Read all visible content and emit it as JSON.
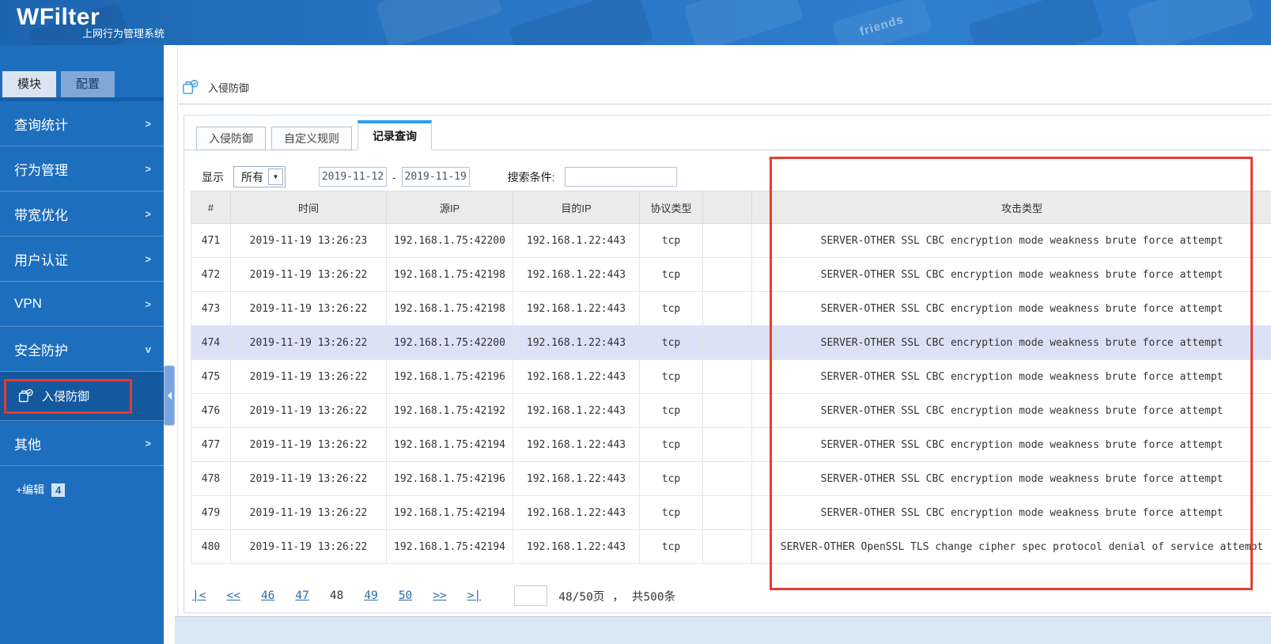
{
  "banner": {
    "logo": "WFilter",
    "subtitle": "上网行为管理系统",
    "decor_key_text": "friends"
  },
  "sidebar": {
    "tabs": [
      {
        "label": "模块"
      },
      {
        "label": "配置"
      }
    ],
    "items": [
      {
        "name": "query-statistics",
        "label": "查询统计",
        "arrow": ">"
      },
      {
        "name": "behavior-management",
        "label": "行为管理",
        "arrow": ">"
      },
      {
        "name": "bandwidth-optimize",
        "label": "带宽优化",
        "arrow": ">"
      },
      {
        "name": "user-authentication",
        "label": "用户认证",
        "arrow": ">"
      },
      {
        "name": "vpn",
        "label": "VPN",
        "arrow": ">"
      },
      {
        "name": "security-protection",
        "label": "安全防护",
        "arrow": "v"
      }
    ],
    "submenu": {
      "label": "入侵防御"
    },
    "other": {
      "label": "其他",
      "arrow": ">"
    },
    "edit_label": "+编辑",
    "edit_badge": "4"
  },
  "breadcrumb": {
    "title": "入侵防御"
  },
  "tabs": [
    {
      "name": "intrusion-prevention",
      "label": "入侵防御",
      "active": false
    },
    {
      "name": "custom-rules",
      "label": "自定义规则",
      "active": false
    },
    {
      "name": "record-query",
      "label": "记录查询",
      "active": true
    }
  ],
  "filters": {
    "display_label": "显示",
    "display_value": "所有",
    "date_from": "2019-11-12",
    "date_separator": "-",
    "date_to": "2019-11-19",
    "search_label": "搜索条件:",
    "search_value": ""
  },
  "table": {
    "headers": [
      "#",
      "时间",
      "源IP",
      "目的IP",
      "协议类型",
      "",
      "攻击类型"
    ],
    "highlighted_row": "474",
    "rows": [
      [
        "471",
        "2019-11-19 13:26:23",
        "192.168.1.75:42200",
        "192.168.1.22:443",
        "tcp",
        "",
        "SERVER-OTHER SSL CBC encryption mode weakness brute force attempt"
      ],
      [
        "472",
        "2019-11-19 13:26:22",
        "192.168.1.75:42198",
        "192.168.1.22:443",
        "tcp",
        "",
        "SERVER-OTHER SSL CBC encryption mode weakness brute force attempt"
      ],
      [
        "473",
        "2019-11-19 13:26:22",
        "192.168.1.75:42198",
        "192.168.1.22:443",
        "tcp",
        "",
        "SERVER-OTHER SSL CBC encryption mode weakness brute force attempt"
      ],
      [
        "474",
        "2019-11-19 13:26:22",
        "192.168.1.75:42200",
        "192.168.1.22:443",
        "tcp",
        "",
        "SERVER-OTHER SSL CBC encryption mode weakness brute force attempt"
      ],
      [
        "475",
        "2019-11-19 13:26:22",
        "192.168.1.75:42196",
        "192.168.1.22:443",
        "tcp",
        "",
        "SERVER-OTHER SSL CBC encryption mode weakness brute force attempt"
      ],
      [
        "476",
        "2019-11-19 13:26:22",
        "192.168.1.75:42192",
        "192.168.1.22:443",
        "tcp",
        "",
        "SERVER-OTHER SSL CBC encryption mode weakness brute force attempt"
      ],
      [
        "477",
        "2019-11-19 13:26:22",
        "192.168.1.75:42194",
        "192.168.1.22:443",
        "tcp",
        "",
        "SERVER-OTHER SSL CBC encryption mode weakness brute force attempt"
      ],
      [
        "478",
        "2019-11-19 13:26:22",
        "192.168.1.75:42196",
        "192.168.1.22:443",
        "tcp",
        "",
        "SERVER-OTHER SSL CBC encryption mode weakness brute force attempt"
      ],
      [
        "479",
        "2019-11-19 13:26:22",
        "192.168.1.75:42194",
        "192.168.1.22:443",
        "tcp",
        "",
        "SERVER-OTHER SSL CBC encryption mode weakness brute force attempt"
      ],
      [
        "480",
        "2019-11-19 13:26:22",
        "192.168.1.75:42194",
        "192.168.1.22:443",
        "tcp",
        "",
        "SERVER-OTHER OpenSSL TLS change cipher spec protocol denial of service attempt"
      ]
    ]
  },
  "pagination": {
    "items": [
      {
        "name": "first-page",
        "label": "|<",
        "type": "link"
      },
      {
        "name": "prev-block",
        "label": "<<",
        "type": "link"
      },
      {
        "name": "page-46",
        "label": "46",
        "type": "link"
      },
      {
        "name": "page-47",
        "label": "47",
        "type": "link"
      },
      {
        "name": "page-48",
        "label": "48",
        "type": "current"
      },
      {
        "name": "page-49",
        "label": "49",
        "type": "link"
      },
      {
        "name": "page-50",
        "label": "50",
        "type": "link"
      },
      {
        "name": "next-block",
        "label": ">>",
        "type": "link"
      },
      {
        "name": "last-page",
        "label": ">|",
        "type": "link"
      }
    ],
    "page_input": "",
    "page_info": "48/50页",
    "separator": "，",
    "total_info": "共500条"
  },
  "colors": {
    "banner_blue": "#2a76c4",
    "sidebar_blue": "#1e6ebe",
    "submenu_active": "#14589e",
    "annotation_red": "#ea3b30",
    "tab_accent": "#2b9ff3",
    "row_highlight": "#dbe2f6",
    "header_gray": "#ebebeb",
    "link_blue": "#2a6ca5",
    "scrollbar_strip": "#d9e7f4"
  }
}
